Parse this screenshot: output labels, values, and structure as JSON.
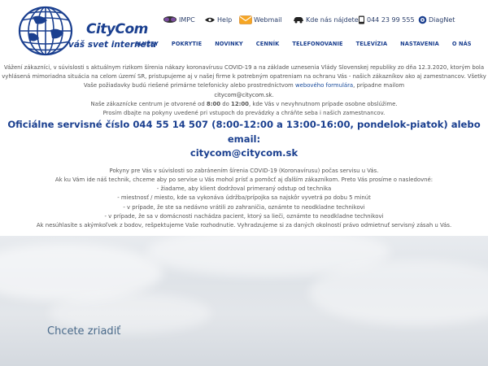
{
  "brand": {
    "name": "CityCom",
    "tagline": "váš svet internetu"
  },
  "toplinks": {
    "impc": "IMPC",
    "help": "Help",
    "webmail": "Webmail",
    "kde": "Kde nás nájdete",
    "phone": "044 23 99 555",
    "diagnet": "DiagNet"
  },
  "nav": {
    "items": [
      "SLUŽBY",
      "POKRYTIE",
      "NOVINKY",
      "CENNÍK",
      "TELEFONOVANIE",
      "TELEVÍZIA",
      "NASTAVENIA",
      "O NÁS"
    ]
  },
  "notice": {
    "p1": "Vážení zákazníci, v súvislosti s aktuálnym rizikom šírenia nákazy koronavírusu COVID-19 a na základe uznesenia Vlády Slovenskej republiky zo dňa 12.3.2020, ktorým bola vyhlásená mimoriadna situácia na celom území SR, pristupujeme aj v našej firme k potrebným opatreniam na ochranu Vás - našich zákazníkov ako aj zamestnancov. Všetky Vaše požiadavky budú riešené primárne telefonicky alebo prostredníctvom ",
    "p1_link": "webového formulára",
    "p1_mid": ", prípadne mailom",
    "p1_email": "citycom@citycom.sk",
    "p1_end": ".",
    "p2_start": "Naše zákaznícke centrum je otvorené od ",
    "p2_from": "8:00",
    "p2_mid": " do ",
    "p2_to": "12:00",
    "p2_end": ", kde Vás v nevyhnutnom prípade osobne obslúžime.",
    "p3": "Prosím dbajte na pokyny uvedené pri vstupoch do prevádzky a chráňte seba i našich zamestnancov.",
    "big1": "Oficiálne servisné číslo 044 55 14 507 (8:00-12:00 a 13:00-16:00, pondelok-piatok) alebo email:",
    "big2": "citycom@citycom.sk",
    "s1": "Pokyny pre Vás v súvislosti so zabránením šírenia COVID-19 (Koronavírusu) počas servisu u Vás.",
    "s2": "Ak ku Vám ide náš technik, chceme aby po servise u Vás mohol prísť a pomôcť aj ďalším zákazníkom. Preto Vás prosíme o nasledovné:",
    "s3": "- žiadame, aby klient dodržoval primeraný odstup od technika",
    "s4": "- miestnosť / miesto, kde sa vykonáva údržba/prípojka sa najskôr vyvetrá po dobu 5 minút",
    "s5": "- v prípade, že ste sa nedávno vrátili zo zahraničia, oznámte to neodkladne technikovi",
    "s6": "- v prípade, že sa v domácnosti nachádza pacient, ktorý sa lieči, oznámte to neodkladne technikovi",
    "s7": "Ak nesúhlasíte s akýmkoľvek z bodov, rešpektujeme Vaše rozhodnutie. Vyhradzujeme si za daných okolností právo odmietnuť servisný zásah u Vás."
  },
  "hero": {
    "title": "Chcete zriadiť"
  },
  "colors": {
    "brand": "#1a3f8f",
    "link": "#1a4c9c",
    "text": "#555555"
  }
}
